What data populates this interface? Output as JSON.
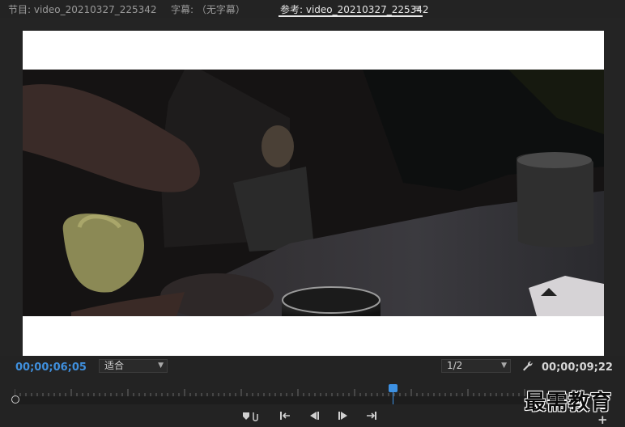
{
  "tabs": [
    {
      "label": "节目: video_20210327_225342",
      "active": false
    },
    {
      "label": "字幕: （无字幕）",
      "active": false
    },
    {
      "label": "参考: video_20210327_225342",
      "active": true
    }
  ],
  "tab_menu_icon": "hamburger-icon",
  "controls": {
    "timecode_current": "00;00;06;05",
    "fit_value": "适合",
    "resolution_value": "1/2",
    "timecode_duration": "00;00;09;22",
    "settings_icon": "wrench-icon"
  },
  "colors": {
    "accent": "#3f8fdd",
    "background": "#232323"
  },
  "ruler": {
    "playhead_position_fraction": 0.64
  },
  "transport": {
    "buttons": [
      "add-marker-icon",
      "step-back-to-in-icon",
      "step-back-frame-icon",
      "step-forward-frame-icon",
      "step-to-out-icon",
      "add-button-icon"
    ]
  },
  "watermark": "最需教育"
}
